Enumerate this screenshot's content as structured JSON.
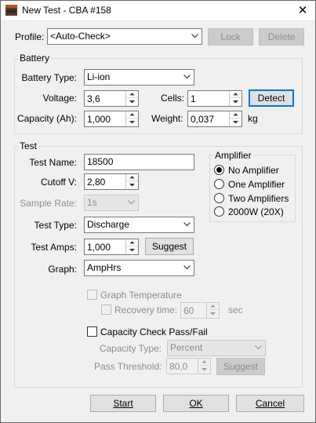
{
  "window": {
    "title": "New Test - CBA #158",
    "close_glyph": "✕"
  },
  "profile": {
    "label": "Profile:",
    "value": "<Auto-Check>",
    "lock_label": "Lock",
    "delete_label": "Delete"
  },
  "battery": {
    "group_label": "Battery",
    "type_label": "Battery Type:",
    "type_value": "Li-ion",
    "voltage_label": "Voltage:",
    "voltage_value": "3,6",
    "cells_label": "Cells:",
    "cells_value": "1",
    "detect_label": "Detect",
    "capacity_label": "Capacity (Ah):",
    "capacity_value": "1,000",
    "weight_label": "Weight:",
    "weight_value": "0,037",
    "weight_unit": "kg"
  },
  "test": {
    "group_label": "Test",
    "name_label": "Test Name:",
    "name_value": "18500",
    "cutoff_label": "Cutoff V:",
    "cutoff_value": "2,80",
    "sample_rate_label": "Sample Rate:",
    "sample_rate_value": "1s",
    "type_label": "Test Type:",
    "type_value": "Discharge",
    "amps_label": "Test Amps:",
    "amps_value": "1,000",
    "suggest_label": "Suggest",
    "graph_label": "Graph:",
    "graph_value": "AmpHrs",
    "graph_temp_label": "Graph Temperature",
    "recovery_label": "Recovery time:",
    "recovery_value": "60",
    "recovery_unit": "sec",
    "capacity_check_label": "Capacity Check Pass/Fail",
    "capacity_type_label": "Capacity Type:",
    "capacity_type_value": "Percent",
    "pass_threshold_label": "Pass Threshold:",
    "pass_threshold_value": "80,0",
    "pass_suggest_label": "Suggest"
  },
  "amplifier": {
    "group_label": "Amplifier",
    "options": [
      "No Amplifier",
      "One Amplifier",
      "Two Amplifiers",
      "2000W (20X)"
    ],
    "selected_index": 0
  },
  "footer": {
    "start_label": "Start",
    "ok_label": "OK",
    "cancel_label": "Cancel"
  },
  "colors": {
    "accent": "#0078d7",
    "window_bg": "#f0f0f0"
  }
}
